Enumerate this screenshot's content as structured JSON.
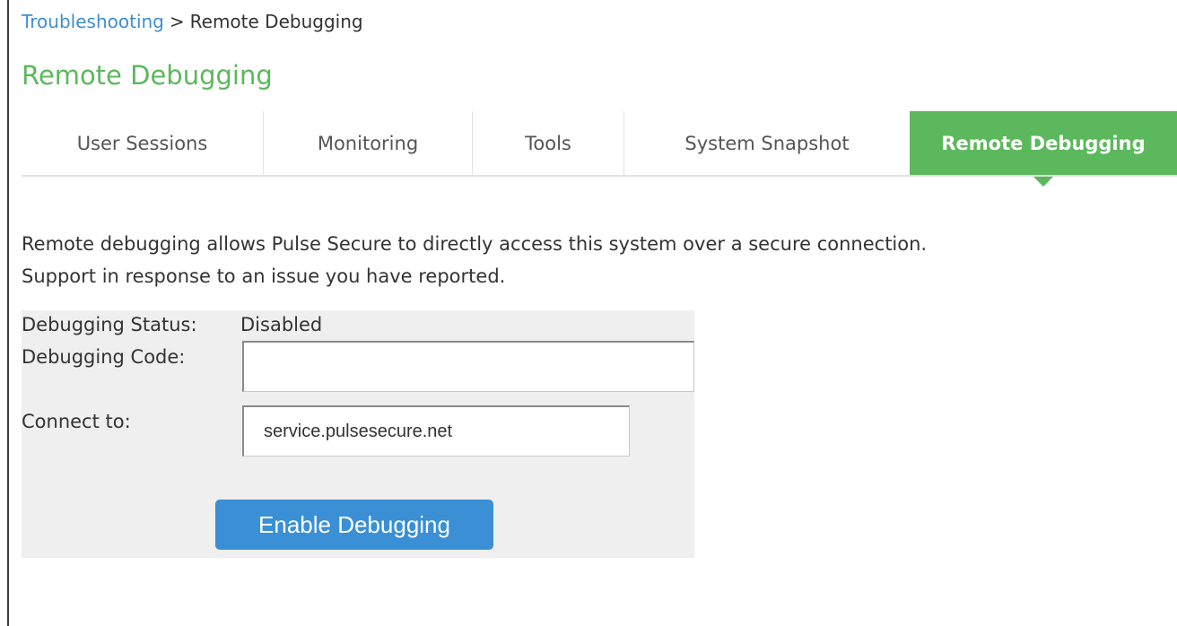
{
  "breadcrumb": {
    "parent": "Troubleshooting",
    "separator": ">",
    "current": "Remote Debugging"
  },
  "page_title": "Remote Debugging",
  "tabs": [
    {
      "label": "User Sessions",
      "active": false
    },
    {
      "label": "Monitoring",
      "active": false
    },
    {
      "label": "Tools",
      "active": false
    },
    {
      "label": "System Snapshot",
      "active": false
    },
    {
      "label": "Remote Debugging",
      "active": true
    }
  ],
  "description": {
    "line1": "Remote debugging allows Pulse Secure to directly access this system over a secure connection.",
    "line2": "Support in response to an issue you have reported."
  },
  "form": {
    "status_label": "Debugging Status:",
    "status_value": "Disabled",
    "code_label": "Debugging Code:",
    "code_value": "",
    "connect_label": "Connect to:",
    "connect_value": "service.pulsesecure.net",
    "button_label": "Enable Debugging"
  },
  "colors": {
    "accent_green": "#5cb85c",
    "link_blue": "#3f8fd2",
    "button_blue": "#3a8fd5",
    "panel_bg": "#efefef"
  }
}
